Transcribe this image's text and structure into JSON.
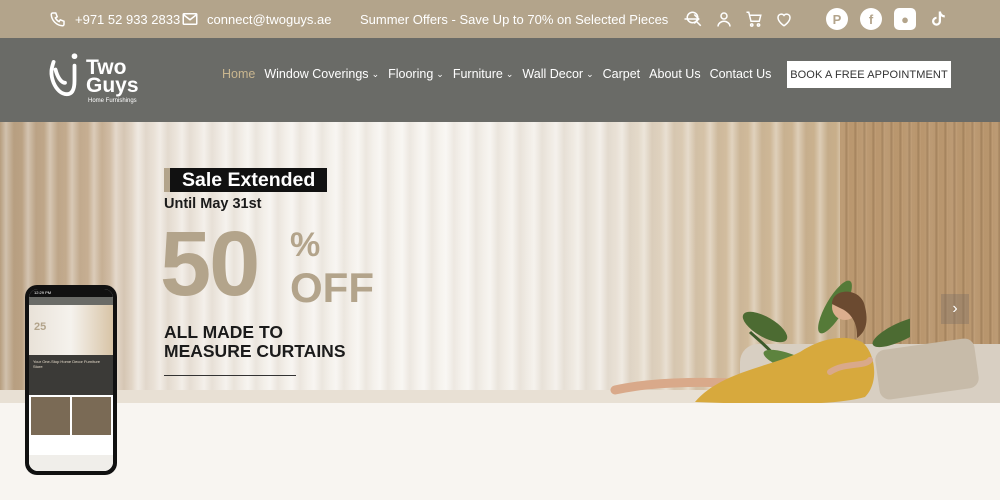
{
  "topbar": {
    "phone": "+971 52 933 2833",
    "email": "connect@twoguys.ae",
    "offer": "Summer Offers - Save Up to 70% on Selected Pieces"
  },
  "logo": {
    "line1": "Two",
    "line2": "Guys",
    "sub": "Home Furnishings"
  },
  "nav": {
    "items": [
      {
        "label": "Home",
        "dropdown": false,
        "active": true
      },
      {
        "label": "Window Coverings",
        "dropdown": true
      },
      {
        "label": "Flooring",
        "dropdown": true
      },
      {
        "label": "Furniture",
        "dropdown": true
      },
      {
        "label": "Wall Decor",
        "dropdown": true
      },
      {
        "label": "Carpet",
        "dropdown": false
      },
      {
        "label": "About Us",
        "dropdown": false
      },
      {
        "label": "Contact Us",
        "dropdown": false
      }
    ],
    "cta": "BOOK A FREE APPOINTMENT"
  },
  "hero": {
    "badge": "Sale Extended",
    "until": "Until May 31st",
    "discount_number": "50",
    "percent_sign": "%",
    "off": "OFF",
    "tagline_line1": "ALL MADE TO",
    "tagline_line2": "MEASURE CURTAINS",
    "next_arrow": "›"
  },
  "phone_mockup": {
    "status_time": "12:29 PM",
    "hero_text": "25",
    "dark_text": "Your One-Stop Home Decor Furniture Store"
  },
  "colors": {
    "topbar_bg": "#b3a48b",
    "navbar_bg": "#6a6b67",
    "accent": "#b3a48b"
  }
}
